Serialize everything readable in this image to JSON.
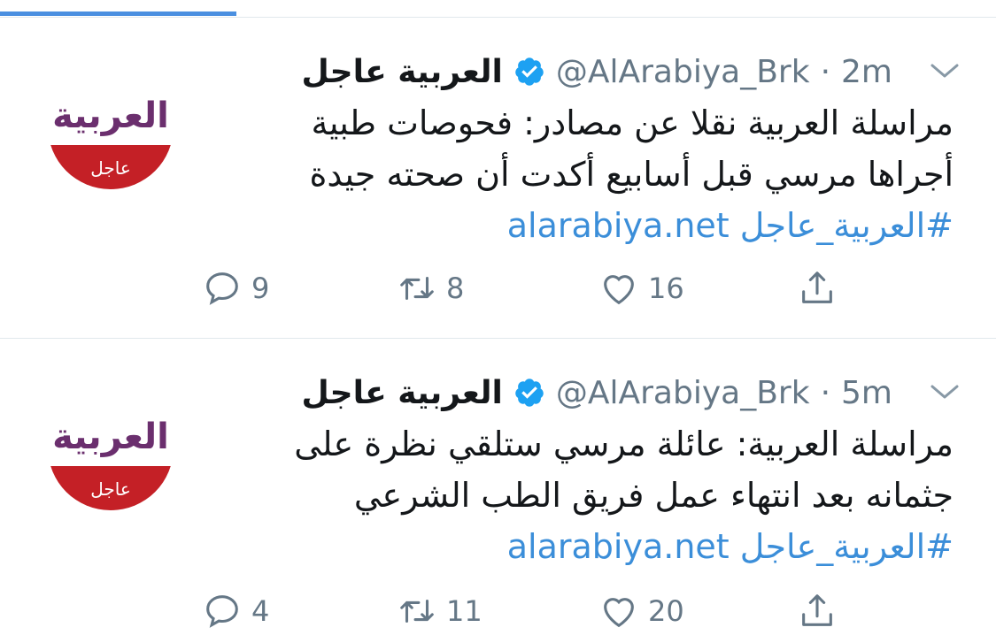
{
  "progress": {
    "fraction": 0.237
  },
  "tweets": [
    {
      "avatar": {
        "brand": "العربية",
        "badge": "عاجل",
        "brand_color": "#6b2f6e",
        "badge_color": "#c42026"
      },
      "name": "العربية عاجل",
      "verified_icon": "verified-badge-icon",
      "handle": "@AlArabiya_Brk",
      "dot": "·",
      "time": "2m",
      "body_lines": [
        "مراسلة العربية نقلا عن مصادر: فحوصات طبية",
        "أجراها مرسي قبل أسابيع أكدت أن صحته جيدة",
        "#العربية_عاجل alarabiya.net"
      ],
      "actions": {
        "reply": "9",
        "retweet": "8",
        "like": "16"
      }
    },
    {
      "avatar": {
        "brand": "العربية",
        "badge": "عاجل",
        "brand_color": "#6b2f6e",
        "badge_color": "#c42026"
      },
      "name": "العربية عاجل",
      "verified_icon": "verified-badge-icon",
      "handle": "@AlArabiya_Brk",
      "dot": "·",
      "time": "5m",
      "body_lines": [
        "مراسلة العربية: عائلة مرسي ستلقي نظرة على",
        "جثمانه بعد انتهاء عمل فريق الطب الشرعي",
        "#العربية_عاجل alarabiya.net"
      ],
      "actions": {
        "reply": "4",
        "retweet": "11",
        "like": "20"
      }
    }
  ],
  "colors": {
    "link": "#3b8ed9",
    "muted": "#657786",
    "text": "#14171a",
    "verified": "#1da1f2"
  }
}
